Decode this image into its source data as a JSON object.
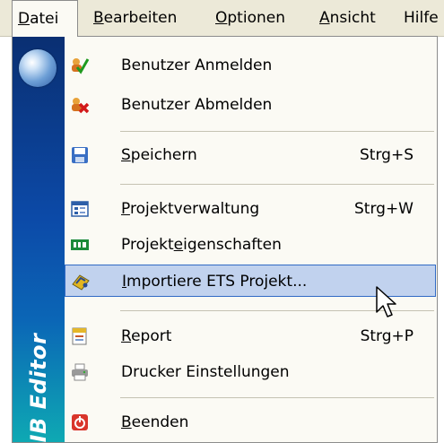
{
  "menubar": {
    "items": [
      {
        "pre": "",
        "ul": "D",
        "post": "atei"
      },
      {
        "pre": "",
        "ul": "B",
        "post": "earbeiten"
      },
      {
        "pre": "",
        "ul": "O",
        "post": "ptionen"
      },
      {
        "pre": "",
        "ul": "A",
        "post": "nsicht"
      },
      {
        "pre": "",
        "ul": "",
        "post": "Hilfe"
      }
    ]
  },
  "strip": {
    "brand": "EIB Editor"
  },
  "menu": {
    "items": [
      {
        "pre": "Benutzer Anmelden",
        "ul": "",
        "post": "",
        "shortcut": "",
        "icon": "login-icon"
      },
      {
        "pre": "Benutzer Abmelden",
        "ul": "",
        "post": "",
        "shortcut": "",
        "icon": "logout-icon"
      },
      {
        "pre": "",
        "ul": "S",
        "post": "peichern",
        "shortcut": "Strg+S",
        "icon": "save-icon"
      },
      {
        "pre": "",
        "ul": "P",
        "post": "rojektverwaltung",
        "shortcut": "Strg+W",
        "icon": "project-management-icon"
      },
      {
        "pre": "Projekt",
        "ul": "e",
        "post": "igenschaften",
        "shortcut": "",
        "icon": "project-properties-icon"
      },
      {
        "pre": "",
        "ul": "I",
        "post": "mportiere ETS Projekt...",
        "shortcut": "",
        "icon": "import-ets-icon"
      },
      {
        "pre": "",
        "ul": "R",
        "post": "eport",
        "shortcut": "Strg+P",
        "icon": "report-icon"
      },
      {
        "pre": "Drucker Einstellungen",
        "ul": "",
        "post": "",
        "shortcut": "",
        "icon": "printer-settings-icon"
      },
      {
        "pre": "",
        "ul": "B",
        "post": "eenden",
        "shortcut": "",
        "icon": "exit-icon"
      }
    ]
  }
}
